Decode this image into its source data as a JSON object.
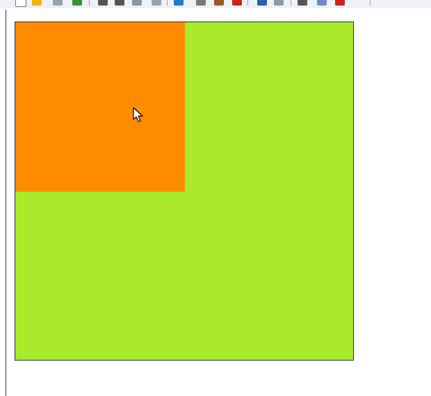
{
  "toolbar": {
    "buttons": [
      {
        "name": "new-document-icon",
        "color": "#ffffff"
      },
      {
        "name": "open-folder-icon",
        "color": "#f0b400"
      },
      {
        "name": "print-icon",
        "color": "#9aa3ad"
      },
      {
        "name": "save-icon",
        "color": "#3b8f3b"
      },
      {
        "name": "cut-icon",
        "color": "#555555"
      },
      {
        "name": "copy-icon",
        "color": "#555555"
      },
      {
        "name": "undo-icon",
        "color": "#8c96a0"
      },
      {
        "name": "page-setup-icon",
        "color": "#9aa3ad"
      },
      {
        "name": "link-icon",
        "color": "#2a78c8"
      },
      {
        "name": "paste-icon",
        "color": "#777777"
      },
      {
        "name": "clipboard-icon",
        "color": "#a0522d"
      },
      {
        "name": "delete-icon",
        "color": "#cc2222"
      },
      {
        "name": "pencil-icon",
        "color": "#2a5fb0"
      },
      {
        "name": "brush-icon",
        "color": "#8899aa"
      },
      {
        "name": "zoom-icon",
        "color": "#555555"
      },
      {
        "name": "shapes-icon",
        "color": "#6a8fc8"
      },
      {
        "name": "text-icon",
        "color": "#cc2222"
      }
    ]
  },
  "canvas": {
    "background_color": "#a9ea2b",
    "border_color": "#1f2a5a",
    "overlay_color": "#ff8c00"
  },
  "cursor": {
    "type": "arrow-pointer"
  }
}
